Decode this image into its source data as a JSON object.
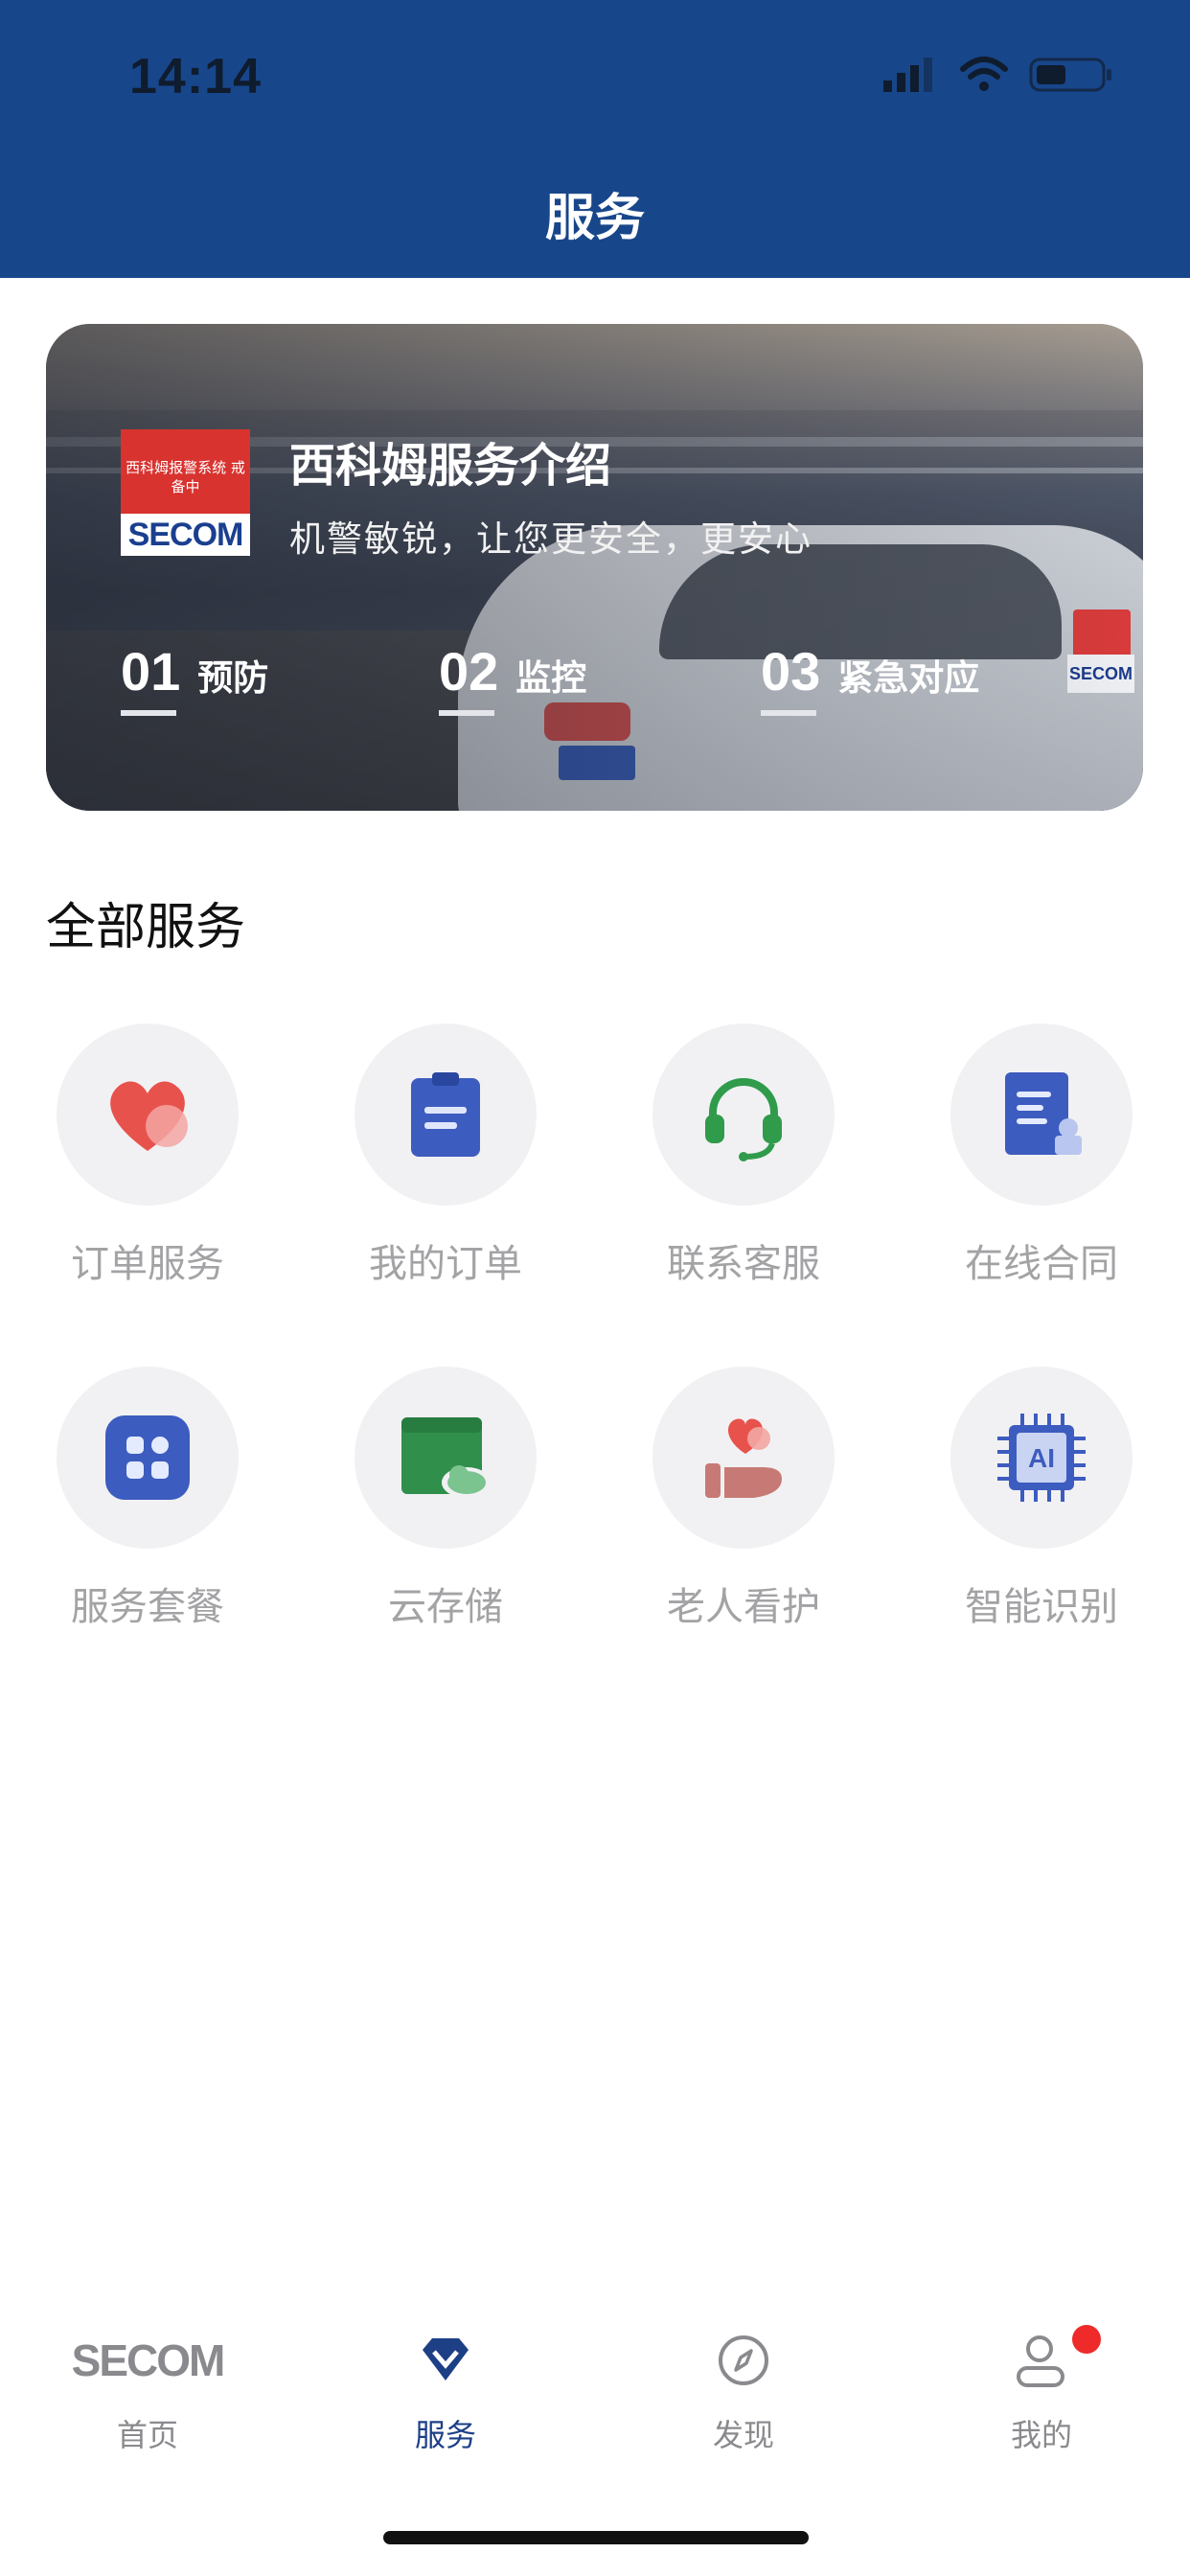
{
  "status": {
    "time": "14:14"
  },
  "header": {
    "title": "服务"
  },
  "banner": {
    "logo_text": "西科姆报警系统 戒备中",
    "logo_word": "SECOM",
    "title": "西科姆服务介绍",
    "subtitle": "机警敏锐，让您更安全，更安心",
    "steps": [
      {
        "num": "01",
        "label": "预防"
      },
      {
        "num": "02",
        "label": "监控"
      },
      {
        "num": "03",
        "label": "紧急对应"
      }
    ]
  },
  "section": {
    "title": "全部服务"
  },
  "services": [
    {
      "label": "订单服务",
      "icon": "heart-icon"
    },
    {
      "label": "我的订单",
      "icon": "clipboard-icon"
    },
    {
      "label": "联系客服",
      "icon": "headset-icon"
    },
    {
      "label": "在线合同",
      "icon": "contract-icon"
    },
    {
      "label": "服务套餐",
      "icon": "grid-package-icon"
    },
    {
      "label": "云存储",
      "icon": "cloud-folder-icon"
    },
    {
      "label": "老人看护",
      "icon": "hand-heart-icon"
    },
    {
      "label": "智能识别",
      "icon": "ai-chip-icon"
    }
  ],
  "tabbar": {
    "items": [
      {
        "label": "首页",
        "icon": "secom-logo-icon",
        "active": false
      },
      {
        "label": "服务",
        "icon": "diamond-icon",
        "active": true
      },
      {
        "label": "发现",
        "icon": "compass-icon",
        "active": false
      },
      {
        "label": "我的",
        "icon": "person-icon",
        "active": false,
        "badge": true
      }
    ],
    "logo_word": "SECOM"
  },
  "colors": {
    "header": "#18468a",
    "active_tab": "#1c3f86",
    "inactive_tab": "#8a8a8e",
    "badge": "#ee2a2a"
  }
}
